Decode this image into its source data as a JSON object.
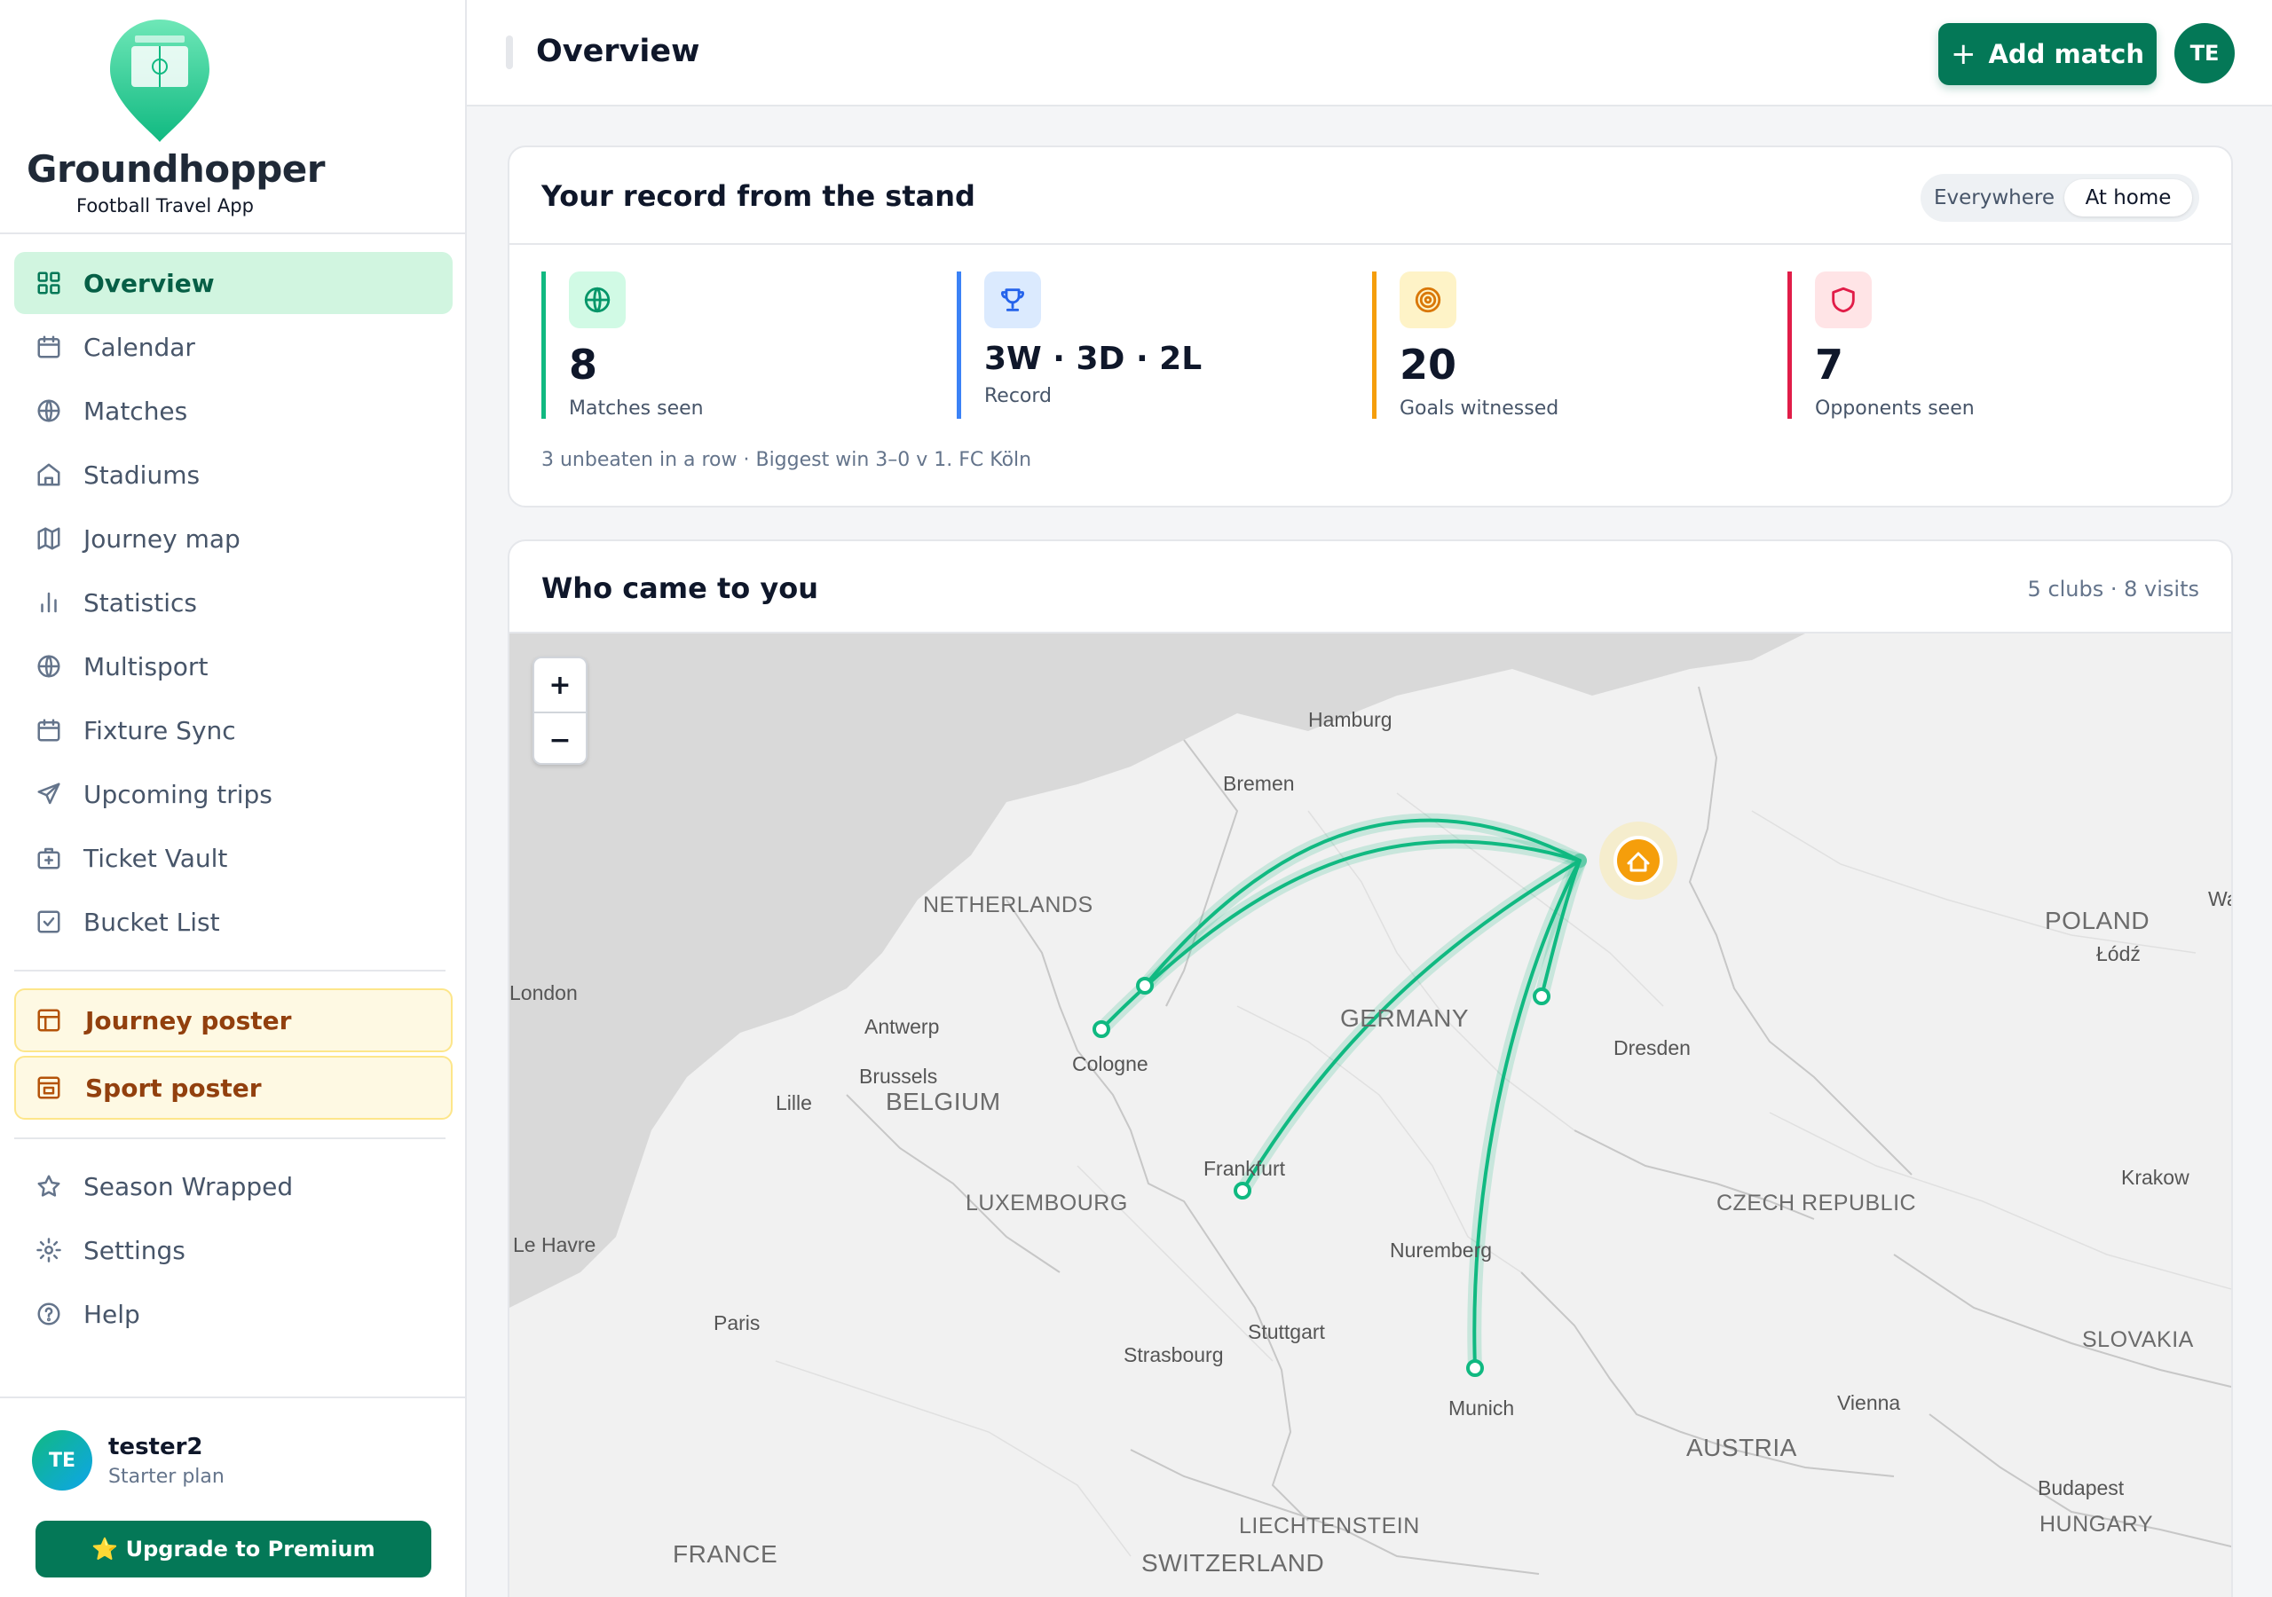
{
  "brand": {
    "name": "Groundhopper",
    "tagline": "Football Travel App"
  },
  "sidebar": {
    "items": [
      {
        "label": "Overview",
        "icon": "grid-icon",
        "active": true
      },
      {
        "label": "Calendar",
        "icon": "calendar-icon"
      },
      {
        "label": "Matches",
        "icon": "ball-icon"
      },
      {
        "label": "Stadiums",
        "icon": "stadium-icon"
      },
      {
        "label": "Journey map",
        "icon": "map-icon"
      },
      {
        "label": "Statistics",
        "icon": "bar-chart-icon"
      },
      {
        "label": "Multisport",
        "icon": "globe-icon"
      },
      {
        "label": "Fixture Sync",
        "icon": "calendar-sync-icon"
      },
      {
        "label": "Upcoming trips",
        "icon": "send-icon"
      },
      {
        "label": "Ticket Vault",
        "icon": "ticket-icon"
      },
      {
        "label": "Bucket List",
        "icon": "checklist-icon"
      }
    ],
    "posters": [
      {
        "label": "Journey poster",
        "icon": "poster-icon"
      },
      {
        "label": "Sport poster",
        "icon": "poster-icon"
      }
    ],
    "footer_items": [
      {
        "label": "Season Wrapped",
        "icon": "star-icon"
      },
      {
        "label": "Settings",
        "icon": "gear-icon"
      },
      {
        "label": "Help",
        "icon": "help-icon"
      }
    ],
    "user": {
      "initials": "TE",
      "name": "tester2",
      "plan": "Starter plan"
    },
    "upgrade_label": "⭐ Upgrade to Premium"
  },
  "header": {
    "title": "Overview",
    "add_label": "Add match",
    "avatar_initials": "TE"
  },
  "record": {
    "title": "Your record from the stand",
    "toggle": {
      "options": [
        "Everywhere",
        "At home"
      ],
      "selected": "At home"
    },
    "stats": [
      {
        "value": "8",
        "label": "Matches seen",
        "color": "#10b981",
        "icon": "ball-icon"
      },
      {
        "value": "3W · 3D · 2L",
        "label": "Record",
        "color": "#3b82f6",
        "icon": "trophy-icon"
      },
      {
        "value": "20",
        "label": "Goals witnessed",
        "color": "#f59e0b",
        "icon": "target-icon"
      },
      {
        "value": "7",
        "label": "Opponents seen",
        "color": "#e11d48",
        "icon": "shield-icon"
      }
    ],
    "note": "3 unbeaten in a row · Biggest win 3–0 v 1. FC Köln"
  },
  "visitors": {
    "title": "Who came to you",
    "meta": "5 clubs · 8 visits",
    "zoom_in": "+",
    "zoom_out": "−",
    "map_labels": {
      "hamburg": "Hamburg",
      "bremen": "Bremen",
      "netherlands": "NETHERLANDS",
      "london": "London",
      "antwerp": "Antwerp",
      "brussels": "Brussels",
      "lille": "Lille",
      "belgium": "BELGIUM",
      "cologne": "Cologne",
      "germany": "GERMANY",
      "dresden": "Dresden",
      "frankfurt": "Frankfurt",
      "luxembourg": "LUXEMBOURG",
      "le_havre": "Le Havre",
      "nuremberg": "Nuremberg",
      "czech": "CZECH REPUBLIC",
      "poland": "POLAND",
      "lodz": "Łódź",
      "krakow": "Krakow",
      "paris": "Paris",
      "stuttgart": "Stuttgart",
      "strasbourg": "Strasbourg",
      "slovakia": "SLOVAKIA",
      "munich": "Munich",
      "vienna": "Vienna",
      "austria": "AUSTRIA",
      "budapest": "Budapest",
      "hungary": "HUNGARY",
      "liechtenstein": "LIECHTENSTEIN",
      "switzerland": "SWITZERLAND",
      "france": "FRANCE",
      "wa": "Wa"
    }
  },
  "colors": {
    "accent": "#047857",
    "route": "#10b981",
    "home": "#f59e0b"
  }
}
